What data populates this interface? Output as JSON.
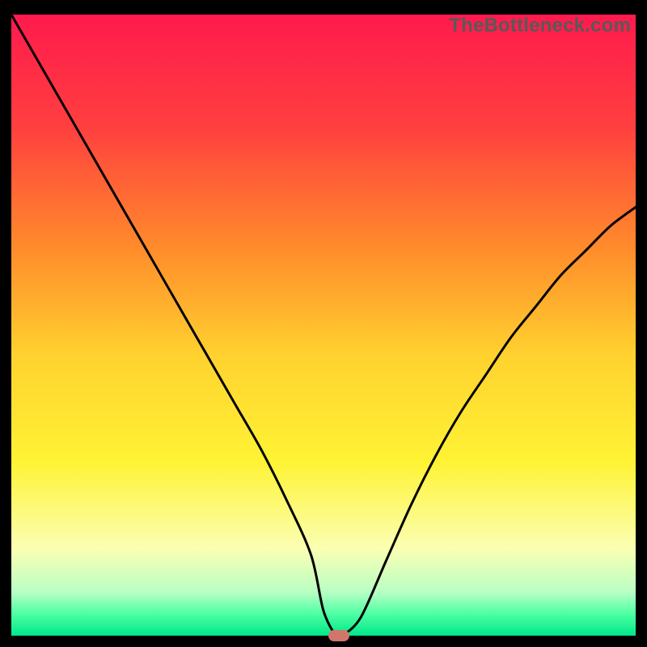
{
  "watermark": "TheBottleneck.com",
  "chart_data": {
    "type": "line",
    "title": "",
    "xlabel": "",
    "ylabel": "",
    "xlim": [
      0,
      100
    ],
    "ylim": [
      0,
      100
    ],
    "grid": false,
    "series": [
      {
        "name": "curve",
        "x": [
          0,
          4,
          8,
          12,
          16,
          20,
          24,
          28,
          32,
          36,
          40,
          44,
          48,
          50,
          52,
          53,
          56,
          60,
          64,
          68,
          72,
          76,
          80,
          84,
          88,
          92,
          96,
          100
        ],
        "y": [
          100,
          93,
          86,
          79,
          72,
          65,
          58,
          51,
          44,
          37,
          30,
          22,
          13,
          4,
          0,
          0,
          3,
          12,
          21,
          29,
          36,
          42,
          48,
          53,
          58,
          62,
          66,
          69
        ]
      }
    ],
    "min_marker": {
      "x": 52.5,
      "y": 0
    },
    "gradient_stops": [
      {
        "pos": 0.0,
        "color": "#ff1a4d"
      },
      {
        "pos": 0.18,
        "color": "#ff3f3f"
      },
      {
        "pos": 0.38,
        "color": "#ff8d2b"
      },
      {
        "pos": 0.55,
        "color": "#ffd22f"
      },
      {
        "pos": 0.72,
        "color": "#fff334"
      },
      {
        "pos": 0.86,
        "color": "#fbffb3"
      },
      {
        "pos": 0.93,
        "color": "#b8ffc4"
      },
      {
        "pos": 0.965,
        "color": "#4dffa3"
      },
      {
        "pos": 1.0,
        "color": "#00e88b"
      }
    ]
  }
}
